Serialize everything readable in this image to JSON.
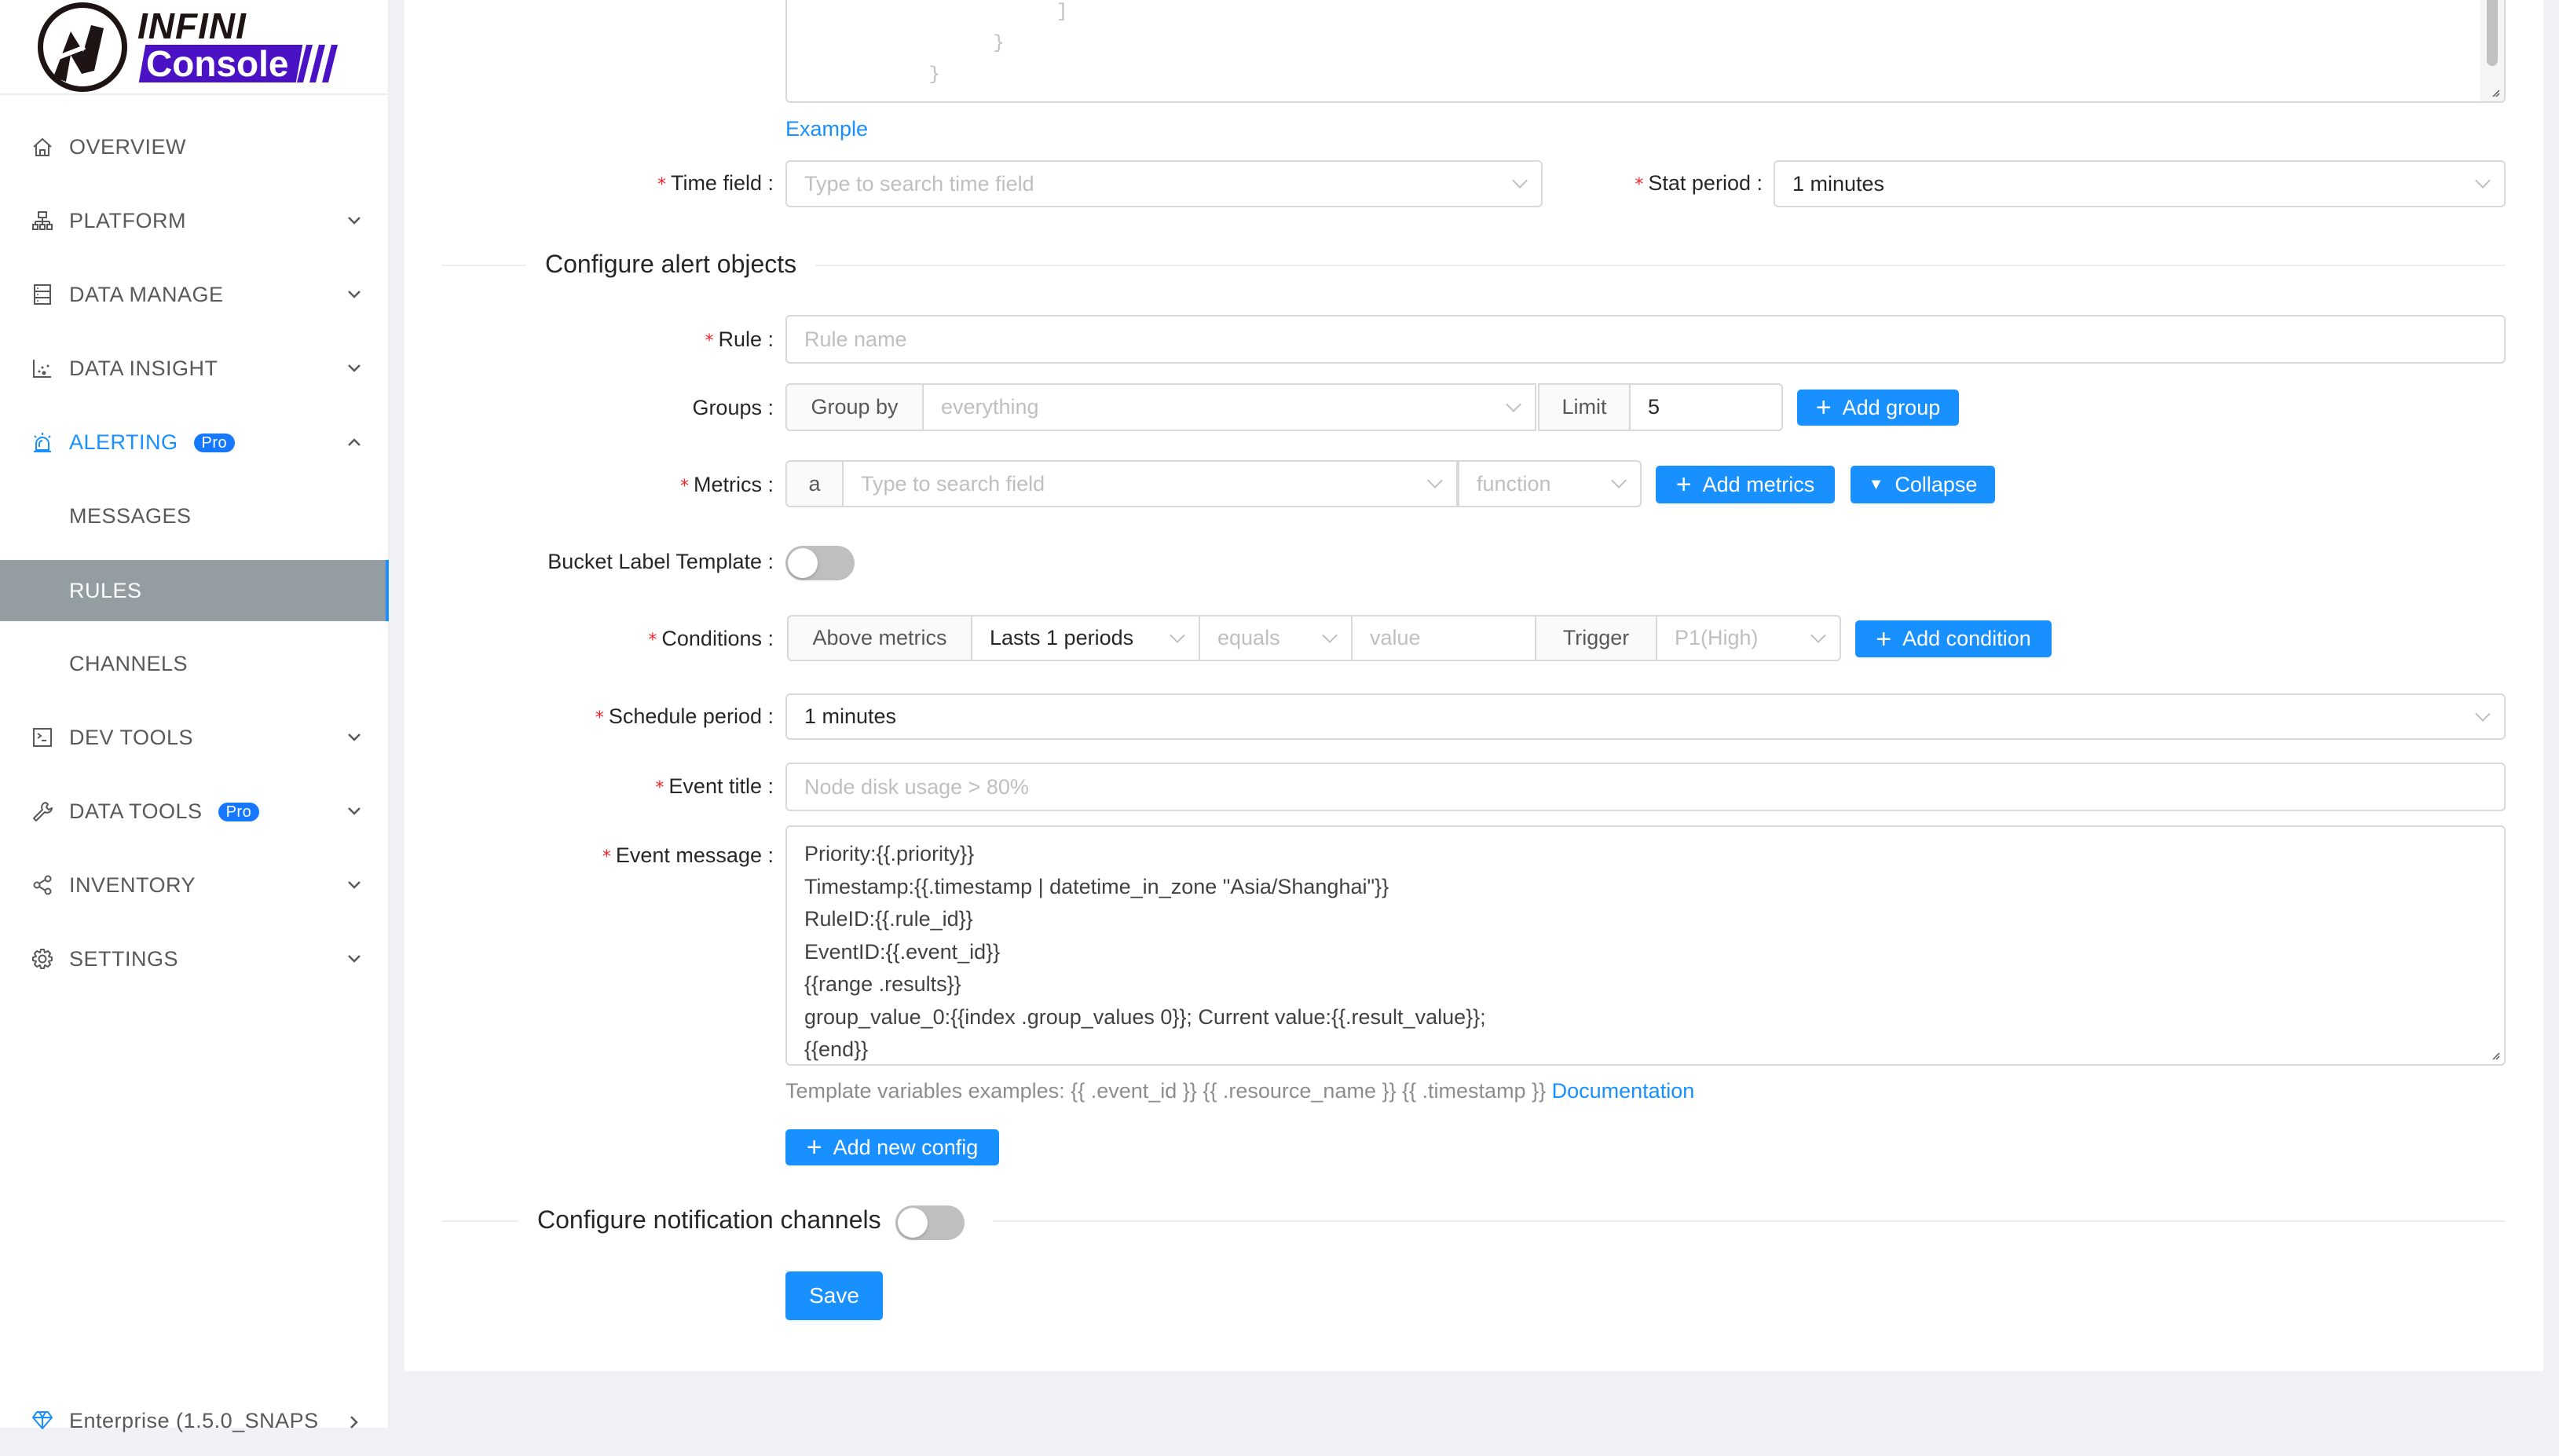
{
  "brand": {
    "line1": "INFINI",
    "line2": "Console",
    "accent": "#4a12c4"
  },
  "sidebar": {
    "items": [
      {
        "label": "OVERVIEW",
        "icon": "home-icon",
        "has_chevron": false
      },
      {
        "label": "PLATFORM",
        "icon": "cluster-icon",
        "has_chevron": true
      },
      {
        "label": "DATA MANAGE",
        "icon": "database-icon",
        "has_chevron": true
      },
      {
        "label": "DATA INSIGHT",
        "icon": "dot-chart-icon",
        "has_chevron": true
      },
      {
        "label": "ALERTING",
        "icon": "alarm-icon",
        "badge": "Pro",
        "has_chevron": true,
        "expanded": true
      },
      {
        "label": "MESSAGES",
        "sub": true
      },
      {
        "label": "RULES",
        "sub": true,
        "selected": true
      },
      {
        "label": "CHANNELS",
        "sub": true
      },
      {
        "label": "DEV TOOLS",
        "icon": "terminal-icon",
        "has_chevron": true
      },
      {
        "label": "DATA TOOLS",
        "icon": "wrench-icon",
        "badge": "Pro",
        "has_chevron": true
      },
      {
        "label": "INVENTORY",
        "icon": "share-icon",
        "has_chevron": true
      },
      {
        "label": "SETTINGS",
        "icon": "gear-icon",
        "has_chevron": true
      }
    ],
    "footer": {
      "label": "Enterprise (1.5.0_SNAPS",
      "icon": "diamond-icon"
    }
  },
  "form": {
    "code_lines": [
      "            ]",
      "        }",
      "    }"
    ],
    "example_link": "Example",
    "time_field": {
      "label": "Time field",
      "placeholder": "Type to search time field"
    },
    "stat_period": {
      "label": "Stat period",
      "value": "1 minutes"
    },
    "section_alert_objects": "Configure alert objects",
    "rule": {
      "label": "Rule",
      "placeholder": "Rule name"
    },
    "groups": {
      "label": "Groups",
      "addon": "Group by",
      "placeholder": "everything",
      "limit_label": "Limit",
      "limit_value": "5",
      "add_button": "Add group"
    },
    "metrics": {
      "label": "Metrics",
      "prefix": "a",
      "field_placeholder": "Type to search field",
      "function_placeholder": "function",
      "add_button": "Add metrics",
      "collapse_button": "Collapse"
    },
    "bucket_label_template": {
      "label": "Bucket Label Template",
      "enabled": false
    },
    "conditions": {
      "label": "Conditions",
      "addon": "Above metrics",
      "periods": "Lasts 1 periods",
      "operator_placeholder": "equals",
      "value_placeholder": "value",
      "trigger_label": "Trigger",
      "priority_placeholder": "P1(High)",
      "add_button": "Add condition"
    },
    "schedule_period": {
      "label": "Schedule period",
      "value": "1 minutes"
    },
    "event_title": {
      "label": "Event title",
      "placeholder": "Node disk usage > 80%"
    },
    "event_message": {
      "label": "Event message",
      "lines": [
        "Priority:{{.priority}}",
        "Timestamp:{{.timestamp | datetime_in_zone \"Asia/Shanghai\"}}",
        "RuleID:{{.rule_id}}",
        "EventID:{{.event_id}}",
        "{{range .results}}",
        "group_value_0:{{index .group_values 0}}; Current value:{{.result_value}};",
        "{{end}}"
      ]
    },
    "template_hint": "Template variables examples: {{ .event_id }} {{ .resource_name }} {{ .timestamp }} ",
    "documentation_link": "Documentation",
    "add_config_button": "Add new config",
    "section_notification": "Configure notification channels",
    "notification_enabled": false,
    "save_button": "Save"
  },
  "colors": {
    "primary": "#1890ff",
    "required": "#f5222d",
    "selected_bg": "#949ea2"
  }
}
